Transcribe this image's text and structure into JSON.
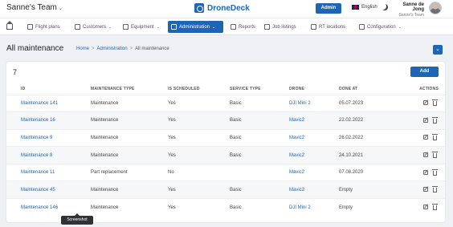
{
  "header": {
    "team": "Sanne's Team",
    "brand": "DroneDeck",
    "admin_button": "Admin",
    "language": "English",
    "user_name": "Sanne de Jong",
    "user_team": "Sanne's Team"
  },
  "nav": {
    "items": [
      {
        "label": "Flight plans",
        "icon": "plane-icon",
        "dropdown": false
      },
      {
        "label": "Customers",
        "icon": "customers-icon",
        "dropdown": true
      },
      {
        "label": "Equipment",
        "icon": "equipment-icon",
        "dropdown": true
      },
      {
        "label": "Administration",
        "icon": "admin-icon",
        "dropdown": true,
        "active": true
      },
      {
        "label": "Reports",
        "icon": "reports-icon",
        "dropdown": false
      },
      {
        "label": "Job listings",
        "icon": "jobs-icon",
        "dropdown": false
      },
      {
        "label": "RT locations",
        "icon": "location-icon",
        "dropdown": false
      },
      {
        "label": "Configuration",
        "icon": "gear-icon",
        "dropdown": true
      }
    ]
  },
  "page": {
    "title": "All maintenance",
    "breadcrumb": [
      "Home",
      "Administration",
      "All maintenance"
    ]
  },
  "table": {
    "count": "7",
    "add_label": "Add",
    "columns": [
      "ID",
      "MAINTENANCE TYPE",
      "IS SCHEDULED",
      "SERVICE TYPE",
      "DRONE",
      "DONE AT",
      "ACTIONS"
    ],
    "rows": [
      [
        "Maintenance 141",
        "Maintenance",
        "Yes",
        "Basic",
        "DJI Mini 2",
        "05.07.2023"
      ],
      [
        "Maintenance 16",
        "Maintenance",
        "Yes",
        "Basic",
        "Mavic2",
        "22.02.2022"
      ],
      [
        "Maintenance 9",
        "Maintenance",
        "Yes",
        "Basic",
        "Mavic2",
        "26.02.2022"
      ],
      [
        "Maintenance 8",
        "Maintenance",
        "Yes",
        "Basic",
        "Mavic2",
        "24.10.2021"
      ],
      [
        "Maintenance 11",
        "Part replacement",
        "No",
        "",
        "Mavic2",
        "07.08.2020"
      ],
      [
        "Maintenance 45",
        "Maintenance",
        "Yes",
        "Basic",
        "Mavic2",
        "Empty"
      ],
      [
        "Maintenance 146",
        "Maintenance",
        "Yes",
        "Basic",
        "DJI Mini 2",
        "Empty"
      ]
    ]
  },
  "tooltip": "Screenshot"
}
